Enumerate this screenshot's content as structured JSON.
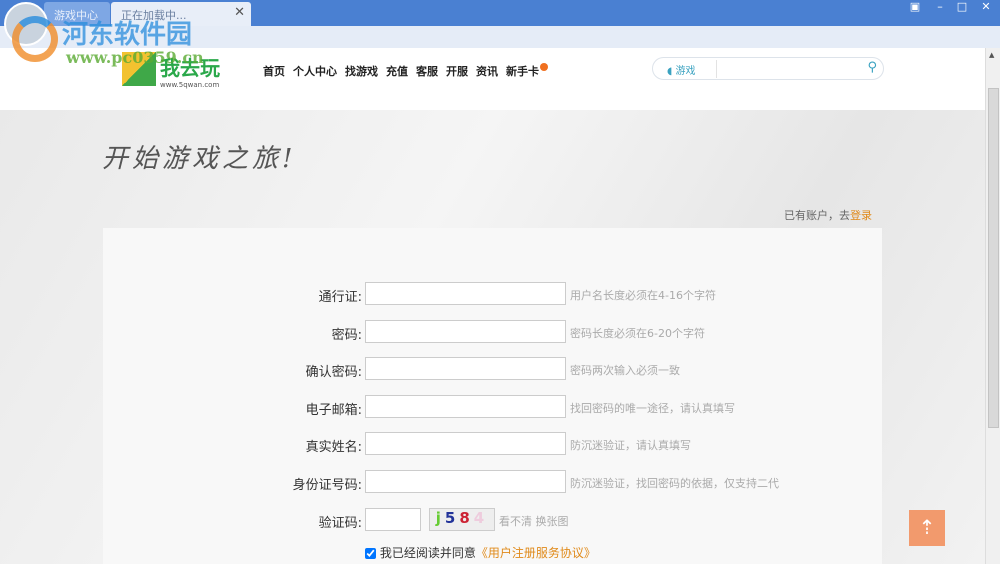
{
  "browser": {
    "tabs": [
      {
        "label": "游戏中心"
      },
      {
        "label": "正在加载中..."
      }
    ],
    "close_tab": "✕",
    "win": {
      "menu": "▣",
      "min": "–",
      "max": "□",
      "close": "✕"
    }
  },
  "header": {
    "logo_text": "我去玩",
    "logo_url": "www.5qwan.com",
    "nav": [
      "首页",
      "个人中心",
      "找游戏",
      "充值",
      "客服",
      "开服",
      "资讯",
      "新手卡"
    ],
    "search": {
      "category": "游戏",
      "placeholder": "",
      "icon": "search-icon"
    }
  },
  "hero": {
    "slogan": "开始游戏之旅!",
    "have_account": "已有账户，去",
    "login": "登录"
  },
  "form": {
    "fields": [
      {
        "label": "通行证:",
        "value": "",
        "hint": "用户名长度必须在4-16个字符"
      },
      {
        "label": "密码:",
        "value": "",
        "hint": "密码长度必须在6-20个字符"
      },
      {
        "label": "确认密码:",
        "value": "",
        "hint": "密码两次输入必须一致"
      },
      {
        "label": "电子邮箱:",
        "value": "",
        "hint": "找回密码的唯一途径，请认真填写"
      },
      {
        "label": "真实姓名:",
        "value": "",
        "hint": "防沉迷验证，请认真填写"
      },
      {
        "label": "身份证号码:",
        "value": "",
        "hint": "防沉迷验证，找回密码的依据，仅支持二代"
      }
    ],
    "captcha": {
      "label": "验证码:",
      "value": "",
      "chars": [
        "j",
        "5",
        "8",
        "4"
      ],
      "refresh": "看不清 换张图"
    },
    "agree": {
      "text": "我已经阅读并同意",
      "link": "《用户注册服务协议》",
      "checked": true
    }
  },
  "watermark": {
    "title": "河东软件园",
    "url": "www.pc0359.cn"
  },
  "colors": {
    "titlebar": "#4a80d2",
    "accent": "#e08a1a",
    "totop": "#f29a6d"
  }
}
